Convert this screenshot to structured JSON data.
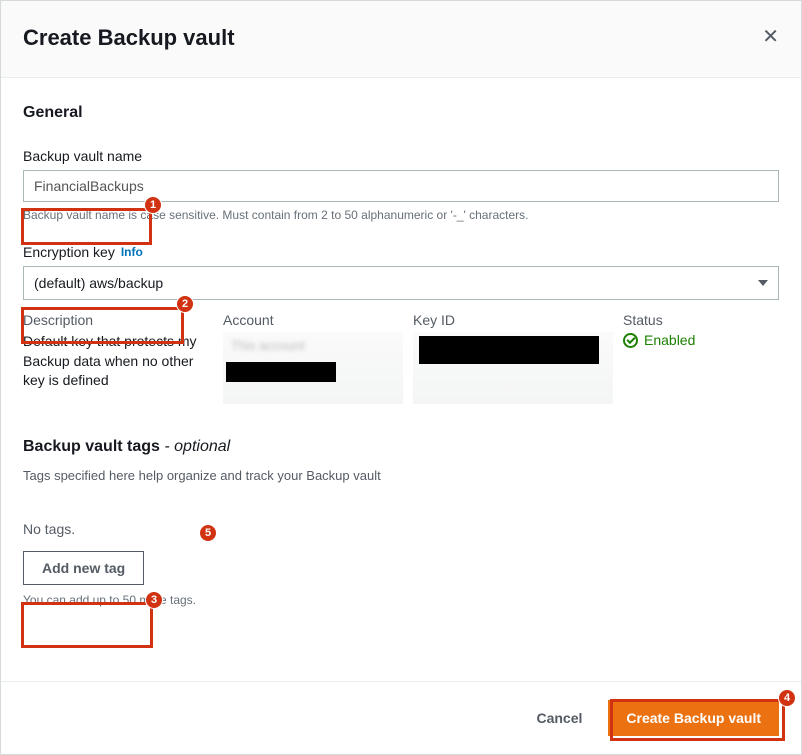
{
  "header": {
    "title": "Create Backup vault"
  },
  "general": {
    "heading": "General",
    "vault_name_label": "Backup vault name",
    "vault_name_value": "FinancialBackups",
    "vault_name_hint": "Backup vault name is case sensitive. Must contain from 2 to 50 alphanumeric or '-_' characters.",
    "encryption_label": "Encryption key",
    "info_label": "Info",
    "encryption_value": "(default) aws/backup",
    "columns": {
      "description_h": "Description",
      "description": "Default key that protects my Backup data when no other key is defined",
      "account_h": "Account",
      "account_blur": "This account",
      "keyid_h": "Key ID",
      "status_h": "Status",
      "status_value": "Enabled"
    }
  },
  "tags": {
    "heading": "Backup vault tags",
    "optional": " - optional",
    "description": "Tags specified here help organize and track your Backup vault",
    "no_tags": "No tags.",
    "add_button": "Add new tag",
    "limit": "You can add up to 50 more tags."
  },
  "footer": {
    "cancel": "Cancel",
    "create": "Create Backup vault"
  },
  "callouts": [
    "1",
    "2",
    "3",
    "4",
    "5"
  ]
}
